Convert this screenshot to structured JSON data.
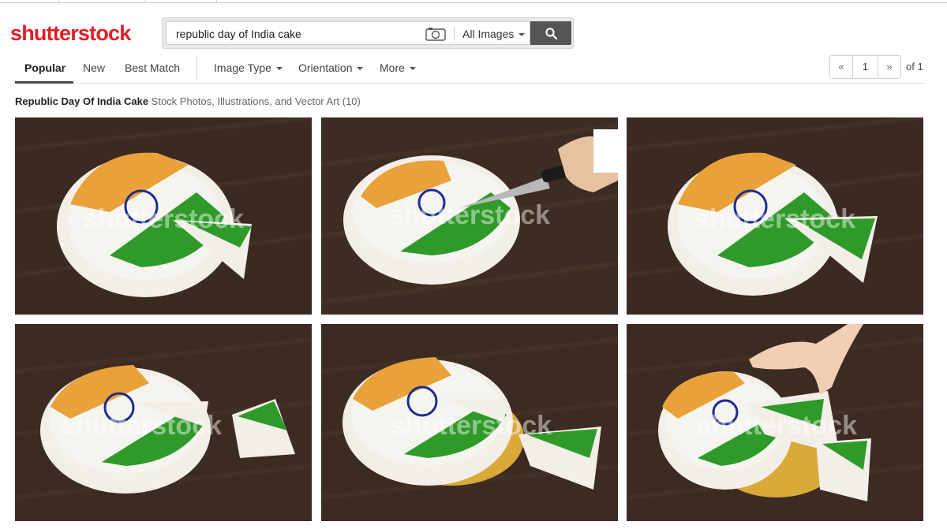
{
  "brand": {
    "logo_text": "shutterstock",
    "color": "#e21f26"
  },
  "search": {
    "query": "republic day of India cake",
    "camera_icon": "camera-icon",
    "asset_type": "All Images",
    "submit_icon": "magnifier-icon"
  },
  "sort_tabs": [
    {
      "label": "Popular",
      "active": true
    },
    {
      "label": "New",
      "active": false
    },
    {
      "label": "Best Match",
      "active": false
    }
  ],
  "filters": [
    {
      "label": "Image Type"
    },
    {
      "label": "Orientation"
    },
    {
      "label": "More"
    }
  ],
  "pagination": {
    "prev": "«",
    "current": "1",
    "next": "»",
    "total": "of 1"
  },
  "results": {
    "title": "Republic Day Of India Cake",
    "subtitle": "Stock Photos, Illustrations, and Vector Art (10)"
  },
  "watermark": "shutterstock",
  "images": [
    {
      "alt": "cake-flag-slice-cut"
    },
    {
      "alt": "cake-flag-knife"
    },
    {
      "alt": "cake-flag-slice-cut-2"
    },
    {
      "alt": "cake-flag-slice-separate"
    },
    {
      "alt": "cake-flag-slice-on-board"
    },
    {
      "alt": "cake-flag-hand-slices"
    }
  ],
  "colors": {
    "saffron": "#e9a13a",
    "white": "#f5f5f0",
    "green": "#2f9a2a",
    "chakra": "#1d2c8f",
    "table": "#3a2a22"
  }
}
